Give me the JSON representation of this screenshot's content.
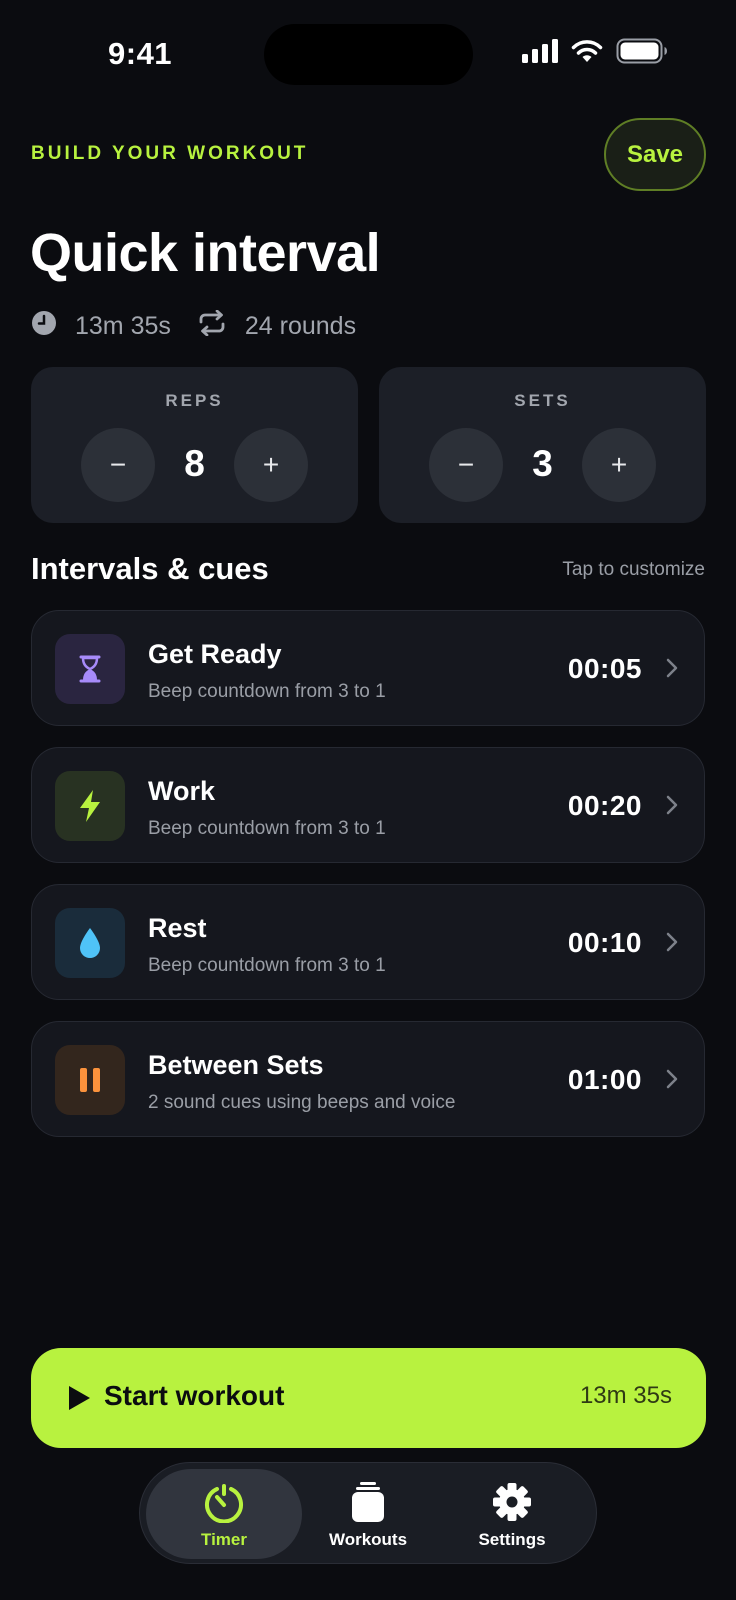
{
  "status_bar": {
    "time": "9:41"
  },
  "header": {
    "eyebrow": "BUILD YOUR WORKOUT",
    "save_label": "Save",
    "title": "Quick interval",
    "total_duration": "13m 35s",
    "rounds": "24 rounds"
  },
  "steppers": {
    "reps": {
      "label": "REPS",
      "value": "8",
      "minus": "−",
      "plus": "+"
    },
    "sets": {
      "label": "SETS",
      "value": "3",
      "minus": "−",
      "plus": "+"
    }
  },
  "intervals_section": {
    "title": "Intervals & cues",
    "hint": "Tap to customize",
    "items": [
      {
        "name": "Get Ready",
        "subtitle": "Beep countdown from 3 to 1",
        "duration": "00:05",
        "icon": "hourglass-icon",
        "color": "#a78bfa"
      },
      {
        "name": "Work",
        "subtitle": "Beep countdown from 3 to 1",
        "duration": "00:20",
        "icon": "bolt-icon",
        "color": "#b8f23f"
      },
      {
        "name": "Rest",
        "subtitle": "Beep countdown from 3 to 1",
        "duration": "00:10",
        "icon": "droplet-icon",
        "color": "#4fc3f7"
      },
      {
        "name": "Between Sets",
        "subtitle": "2 sound cues using beeps and voice",
        "duration": "01:00",
        "icon": "pause-icon",
        "color": "#fb923c"
      }
    ]
  },
  "start_button": {
    "label": "Start workout",
    "duration": "13m 35s"
  },
  "tabbar": {
    "tabs": [
      {
        "label": "Timer",
        "icon": "timer-icon",
        "active": true
      },
      {
        "label": "Workouts",
        "icon": "stack-icon",
        "active": false
      },
      {
        "label": "Settings",
        "icon": "gear-icon",
        "active": false
      }
    ]
  },
  "colors": {
    "accent": "#b8f23f",
    "background": "#0b0c10",
    "card": "#1c1f27"
  }
}
